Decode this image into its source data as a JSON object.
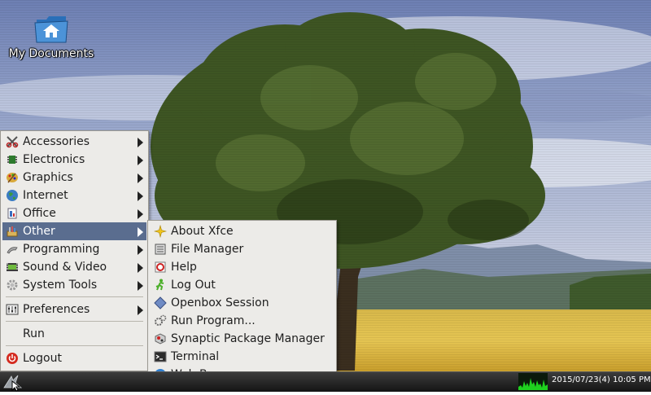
{
  "desktop": {
    "icons": [
      {
        "label": "My Documents",
        "icon": "folder-home-icon"
      }
    ]
  },
  "main_menu": {
    "items": [
      {
        "label": "Accessories",
        "icon": "accessories-icon",
        "submenu": true
      },
      {
        "label": "Electronics",
        "icon": "electronics-icon",
        "submenu": true
      },
      {
        "label": "Graphics",
        "icon": "graphics-icon",
        "submenu": true
      },
      {
        "label": "Internet",
        "icon": "internet-icon",
        "submenu": true
      },
      {
        "label": "Office",
        "icon": "office-icon",
        "submenu": true
      },
      {
        "label": "Other",
        "icon": "other-icon",
        "submenu": true,
        "active": true
      },
      {
        "label": "Programming",
        "icon": "programming-icon",
        "submenu": true
      },
      {
        "label": "Sound & Video",
        "icon": "sound-video-icon",
        "submenu": true
      },
      {
        "label": "System Tools",
        "icon": "system-tools-icon",
        "submenu": true
      },
      {
        "label": "Preferences",
        "icon": "preferences-icon",
        "submenu": true
      },
      {
        "label": "Run",
        "icon": "",
        "submenu": false
      },
      {
        "label": "Logout",
        "icon": "logout-icon",
        "submenu": false
      }
    ]
  },
  "other_submenu": {
    "items": [
      {
        "label": "About Xfce",
        "icon": "about-xfce-icon"
      },
      {
        "label": "File Manager",
        "icon": "file-manager-icon"
      },
      {
        "label": "Help",
        "icon": "help-icon"
      },
      {
        "label": "Log Out",
        "icon": "log-out-icon"
      },
      {
        "label": "Openbox Session",
        "icon": "openbox-icon"
      },
      {
        "label": "Run Program...",
        "icon": "run-program-icon"
      },
      {
        "label": "Synaptic Package Manager",
        "icon": "synaptic-icon"
      },
      {
        "label": "Terminal",
        "icon": "terminal-icon"
      },
      {
        "label": "Web Browser",
        "icon": "web-browser-icon"
      }
    ]
  },
  "panel": {
    "clock": "2015/07/23(4) 10:05 PM",
    "start_icon": "lxde-start-icon",
    "cpu_icon": "cpu-monitor-icon"
  },
  "colors": {
    "menu_bg": "#ecebe8",
    "highlight": "#5a6d8f",
    "panel": "#1e1e1e"
  }
}
